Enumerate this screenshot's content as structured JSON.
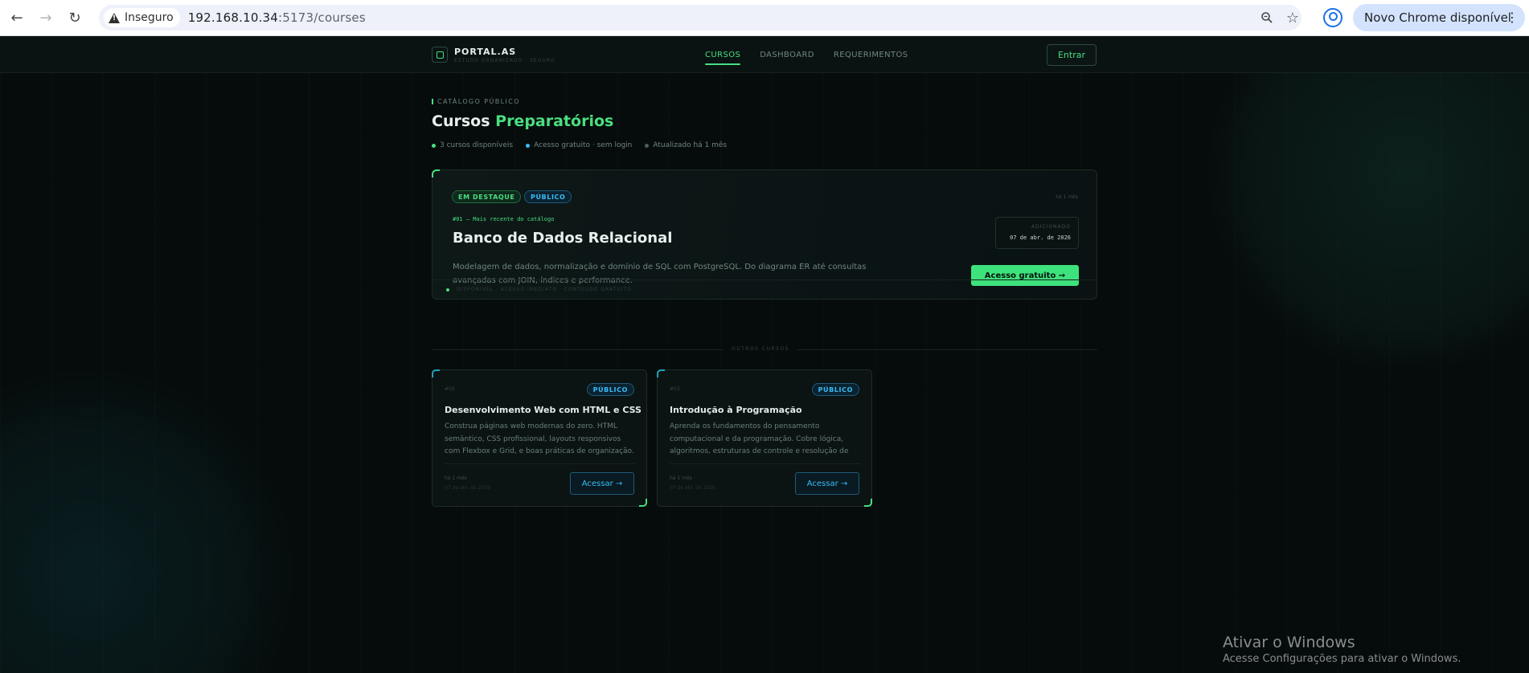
{
  "browser": {
    "insecure_label": "Inseguro",
    "url_host": "192.168.10.34",
    "url_path": ":5173/courses",
    "update_label": "Novo Chrome disponível"
  },
  "header": {
    "brand": "PORTAL.AS",
    "brand_sub": "ESTUDO ORGANIZADO · SEGURO",
    "nav": [
      "CURSOS",
      "DASHBOARD",
      "REQUERIMENTOS"
    ],
    "active_nav": "CURSOS",
    "login_label": "Entrar"
  },
  "hero": {
    "eyebrow": "CATÁLOGO PÚBLICO",
    "title_plain": "Cursos ",
    "title_accent": "Preparatórios",
    "meta": [
      "3 cursos disponíveis",
      "Acesso gratuito · sem login",
      "Atualizado há 1 mês"
    ]
  },
  "featured": {
    "badge_featured": "EM DESTAQUE",
    "badge_public": "PÚBLICO",
    "ago": "há 1 mês",
    "number_line": "#01 — Mais recente do catálogo",
    "title": "Banco de Dados Relacional",
    "description": "Modelagem de dados, normalização e domínio de SQL com PostgreSQL. Do diagrama ER até consultas avançadas com JOIN, índices e performance.",
    "added_label": "ADICIONADO",
    "added_date": "07 de abr. de 2026",
    "cta": "Acesso gratuito →",
    "footer": "DISPONÍVEL · ACESSO IMEDIATO · CONTEÚDO GRATUITO"
  },
  "divider_label": "OUTROS CURSOS",
  "courses": [
    {
      "number": "#02",
      "badge": "PÚBLICO",
      "title": "Desenvolvimento Web com HTML e CSS",
      "description": "Construa páginas web modernas do zero. HTML semântico, CSS profissional, layouts responsivos com Flexbox e Grid, e boas práticas de organização.",
      "ago": "há 1 mês",
      "date": "07 de abr. de 2026",
      "cta": "Acessar →"
    },
    {
      "number": "#03",
      "badge": "PÚBLICO",
      "title": "Introdução à Programação",
      "description": "Aprenda os fundamentos do pensamento computacional e da programação. Cobre lógica, algoritmos, estruturas de controle e resolução de problemas.",
      "ago": "há 1 mês",
      "date": "07 de abr. de 2026",
      "cta": "Acessar →"
    }
  ],
  "windows_watermark": {
    "title": "Ativar o Windows",
    "subtitle": "Acesse Configurações para ativar o Windows."
  },
  "colors": {
    "accent_green": "#4ade80",
    "accent_blue": "#38bdf8",
    "background": "#060c0b"
  }
}
